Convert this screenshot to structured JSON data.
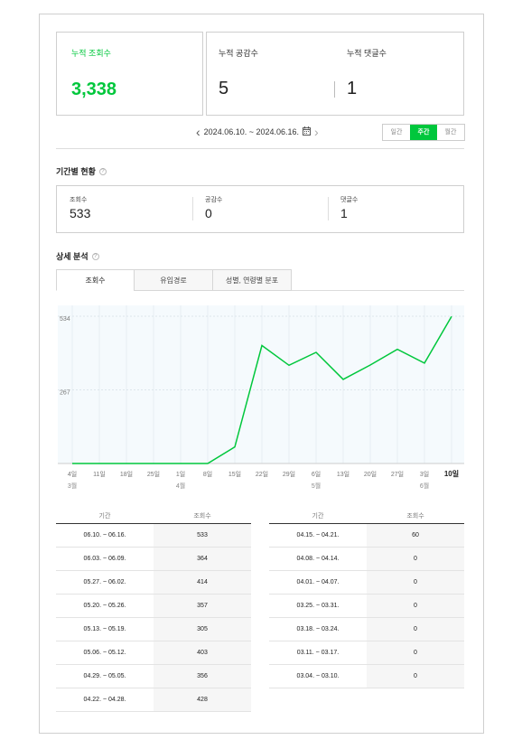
{
  "summary": {
    "views_label": "누적 조회수",
    "views_value": "3,338",
    "likes_label": "누적 공감수",
    "likes_value": "5",
    "comments_label": "누적 댓글수",
    "comments_value": "1"
  },
  "date_nav": {
    "range": "2024.06.10. ~ 2024.06.16.",
    "period_options": [
      "일간",
      "주간",
      "월간"
    ],
    "selected_period": "주간"
  },
  "period_status": {
    "title": "기간별 현황",
    "views_label": "조회수",
    "views_value": "533",
    "likes_label": "공감수",
    "likes_value": "0",
    "comments_label": "댓글수",
    "comments_value": "1"
  },
  "detail": {
    "title": "상세 분석",
    "tabs": [
      "조회수",
      "유입경로",
      "성별, 연령별 분포"
    ]
  },
  "chart_data": {
    "type": "line",
    "x": [
      "4일",
      "11일",
      "18일",
      "25일",
      "1일",
      "8일",
      "15일",
      "22일",
      "29일",
      "6일",
      "13일",
      "20일",
      "27일",
      "3일",
      "10일"
    ],
    "month_labels": [
      {
        "index": 0,
        "label": "3월"
      },
      {
        "index": 4,
        "label": "4월"
      },
      {
        "index": 9,
        "label": "5월"
      },
      {
        "index": 13,
        "label": "6월"
      }
    ],
    "y_ticks": [
      "534",
      "267"
    ],
    "ylim": [
      0,
      534
    ],
    "series": [
      {
        "values": [
          0,
          0,
          0,
          0,
          0,
          0,
          60,
          428,
          356,
          403,
          305,
          357,
          414,
          364,
          533
        ]
      }
    ],
    "line_color": "#00c73c"
  },
  "tables": {
    "col_period": "기간",
    "col_views": "조회수",
    "left": [
      [
        "06.10. ~ 06.16.",
        "533"
      ],
      [
        "06.03. ~ 06.09.",
        "364"
      ],
      [
        "05.27. ~ 06.02.",
        "414"
      ],
      [
        "05.20. ~ 05.26.",
        "357"
      ],
      [
        "05.13. ~ 05.19.",
        "305"
      ],
      [
        "05.06. ~ 05.12.",
        "403"
      ],
      [
        "04.29. ~ 05.05.",
        "356"
      ],
      [
        "04.22. ~ 04.28.",
        "428"
      ]
    ],
    "right": [
      [
        "04.15. ~ 04.21.",
        "60"
      ],
      [
        "04.08. ~ 04.14.",
        "0"
      ],
      [
        "04.01. ~ 04.07.",
        "0"
      ],
      [
        "03.25. ~ 03.31.",
        "0"
      ],
      [
        "03.18. ~ 03.24.",
        "0"
      ],
      [
        "03.11. ~ 03.17.",
        "0"
      ],
      [
        "03.04. ~ 03.10.",
        "0"
      ]
    ]
  }
}
